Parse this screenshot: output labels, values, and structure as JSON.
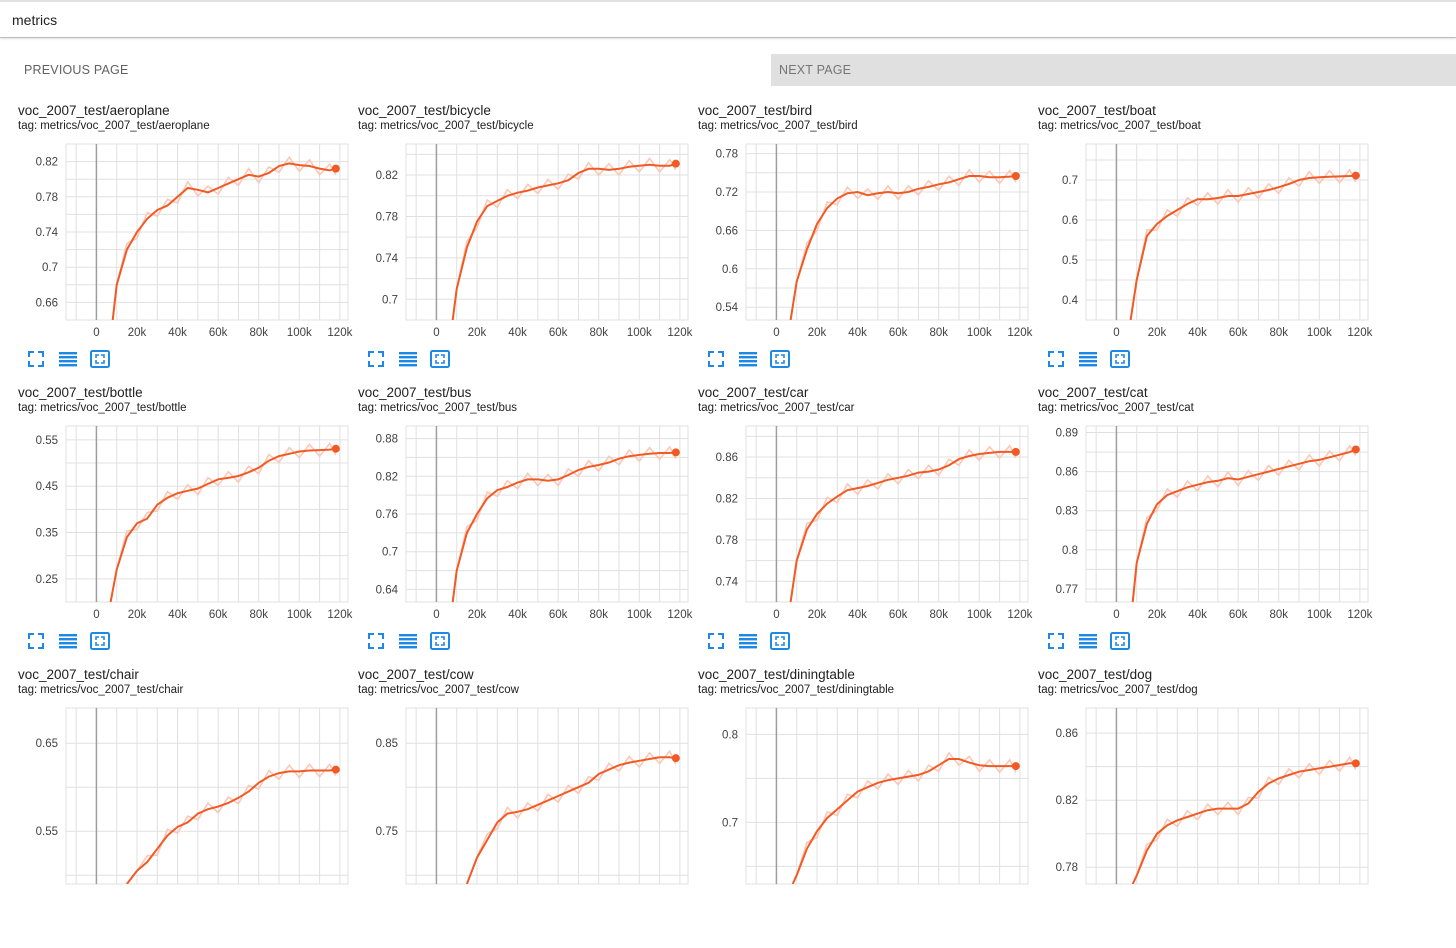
{
  "search": {
    "query": "metrics"
  },
  "pager": {
    "previous_label": "PREVIOUS PAGE",
    "next_label": "NEXT PAGE"
  },
  "colors": {
    "line": "#f15a24",
    "smoothed_raw": "#fcc7b5",
    "grid": "#e0e0e0",
    "zero_axis": "#9e9e9e",
    "icon": "#1e88e5"
  },
  "icons": [
    "fullscreen-icon",
    "toggle-lines-icon",
    "fit-domain-icon"
  ],
  "tag_prefix": "tag:",
  "cards": [
    {
      "title": "voc_2007_test/aeroplane",
      "tag": "metrics/voc_2007_test/aeroplane",
      "chart_data": {
        "type": "line",
        "x_ticks": [
          "0",
          "20k",
          "40k",
          "60k",
          "80k",
          "100k",
          "120k"
        ],
        "y_ticks": [
          "0.66",
          "0.7",
          "0.74",
          "0.78",
          "0.82"
        ],
        "ylim": [
          0.64,
          0.84
        ],
        "x": [
          8,
          10,
          15,
          20,
          25,
          30,
          35,
          40,
          45,
          50,
          55,
          60,
          65,
          70,
          75,
          80,
          85,
          90,
          95,
          100,
          105,
          110,
          115,
          118
        ],
        "y": [
          0.64,
          0.68,
          0.72,
          0.74,
          0.755,
          0.765,
          0.77,
          0.78,
          0.79,
          0.788,
          0.785,
          0.79,
          0.795,
          0.8,
          0.805,
          0.803,
          0.807,
          0.815,
          0.818,
          0.816,
          0.815,
          0.812,
          0.81,
          0.812
        ]
      }
    },
    {
      "title": "voc_2007_test/bicycle",
      "tag": "metrics/voc_2007_test/bicycle",
      "chart_data": {
        "type": "line",
        "x_ticks": [
          "0",
          "20k",
          "40k",
          "60k",
          "80k",
          "100k",
          "120k"
        ],
        "y_ticks": [
          "0.7",
          "0.74",
          "0.78",
          "0.82"
        ],
        "ylim": [
          0.68,
          0.85
        ],
        "x": [
          8,
          10,
          15,
          20,
          25,
          30,
          35,
          40,
          45,
          50,
          55,
          60,
          65,
          70,
          75,
          80,
          85,
          90,
          95,
          100,
          105,
          110,
          115,
          118
        ],
        "y": [
          0.68,
          0.71,
          0.75,
          0.775,
          0.79,
          0.795,
          0.8,
          0.803,
          0.805,
          0.808,
          0.81,
          0.812,
          0.815,
          0.822,
          0.826,
          0.826,
          0.825,
          0.826,
          0.828,
          0.829,
          0.83,
          0.829,
          0.829,
          0.831
        ]
      }
    },
    {
      "title": "voc_2007_test/bird",
      "tag": "metrics/voc_2007_test/bird",
      "chart_data": {
        "type": "line",
        "x_ticks": [
          "0",
          "20k",
          "40k",
          "60k",
          "80k",
          "100k",
          "120k"
        ],
        "y_ticks": [
          "0.54",
          "0.6",
          "0.66",
          "0.72",
          "0.78"
        ],
        "ylim": [
          0.52,
          0.795
        ],
        "x": [
          7,
          10,
          15,
          20,
          25,
          30,
          35,
          40,
          45,
          50,
          55,
          60,
          65,
          70,
          75,
          80,
          85,
          90,
          95,
          100,
          105,
          110,
          115,
          118
        ],
        "y": [
          0.52,
          0.58,
          0.63,
          0.67,
          0.695,
          0.71,
          0.718,
          0.72,
          0.715,
          0.718,
          0.72,
          0.718,
          0.72,
          0.725,
          0.728,
          0.732,
          0.735,
          0.74,
          0.745,
          0.745,
          0.743,
          0.743,
          0.744,
          0.745
        ]
      }
    },
    {
      "title": "voc_2007_test/boat",
      "tag": "metrics/voc_2007_test/boat",
      "chart_data": {
        "type": "line",
        "x_ticks": [
          "0",
          "20k",
          "40k",
          "60k",
          "80k",
          "100k",
          "120k"
        ],
        "y_ticks": [
          "0.4",
          "0.5",
          "0.6",
          "0.7"
        ],
        "ylim": [
          0.35,
          0.79
        ],
        "x": [
          7,
          10,
          15,
          20,
          25,
          30,
          35,
          40,
          45,
          50,
          55,
          60,
          65,
          70,
          75,
          80,
          85,
          90,
          95,
          100,
          105,
          110,
          115,
          118
        ],
        "y": [
          0.35,
          0.45,
          0.56,
          0.59,
          0.61,
          0.625,
          0.64,
          0.652,
          0.652,
          0.655,
          0.66,
          0.66,
          0.665,
          0.67,
          0.675,
          0.682,
          0.69,
          0.7,
          0.705,
          0.707,
          0.708,
          0.709,
          0.71,
          0.711
        ]
      }
    },
    {
      "title": "voc_2007_test/bottle",
      "tag": "metrics/voc_2007_test/bottle",
      "chart_data": {
        "type": "line",
        "x_ticks": [
          "0",
          "20k",
          "40k",
          "60k",
          "80k",
          "100k",
          "120k"
        ],
        "y_ticks": [
          "0.25",
          "0.35",
          "0.45",
          "0.55"
        ],
        "ylim": [
          0.2,
          0.58
        ],
        "x": [
          7,
          10,
          15,
          20,
          25,
          30,
          35,
          40,
          45,
          50,
          55,
          60,
          65,
          70,
          75,
          80,
          85,
          90,
          95,
          100,
          105,
          110,
          115,
          118
        ],
        "y": [
          0.2,
          0.27,
          0.34,
          0.37,
          0.38,
          0.41,
          0.425,
          0.435,
          0.44,
          0.445,
          0.455,
          0.465,
          0.468,
          0.472,
          0.48,
          0.49,
          0.505,
          0.515,
          0.52,
          0.525,
          0.527,
          0.528,
          0.529,
          0.531
        ]
      }
    },
    {
      "title": "voc_2007_test/bus",
      "tag": "metrics/voc_2007_test/bus",
      "chart_data": {
        "type": "line",
        "x_ticks": [
          "0",
          "20k",
          "40k",
          "60k",
          "80k",
          "100k",
          "120k"
        ],
        "y_ticks": [
          "0.64",
          "0.7",
          "0.76",
          "0.82",
          "0.88"
        ],
        "ylim": [
          0.62,
          0.9
        ],
        "x": [
          8,
          10,
          15,
          20,
          25,
          30,
          35,
          40,
          45,
          50,
          55,
          60,
          65,
          70,
          75,
          80,
          85,
          90,
          95,
          100,
          105,
          110,
          115,
          118
        ],
        "y": [
          0.62,
          0.67,
          0.73,
          0.76,
          0.785,
          0.798,
          0.803,
          0.81,
          0.815,
          0.815,
          0.813,
          0.815,
          0.822,
          0.83,
          0.835,
          0.838,
          0.842,
          0.848,
          0.852,
          0.854,
          0.856,
          0.857,
          0.857,
          0.858
        ]
      }
    },
    {
      "title": "voc_2007_test/car",
      "tag": "metrics/voc_2007_test/car",
      "chart_data": {
        "type": "line",
        "x_ticks": [
          "0",
          "20k",
          "40k",
          "60k",
          "80k",
          "100k",
          "120k"
        ],
        "y_ticks": [
          "0.74",
          "0.78",
          "0.82",
          "0.86"
        ],
        "ylim": [
          0.72,
          0.89
        ],
        "x": [
          7,
          10,
          15,
          20,
          25,
          30,
          35,
          40,
          45,
          50,
          55,
          60,
          65,
          70,
          75,
          80,
          85,
          90,
          95,
          100,
          105,
          110,
          115,
          118
        ],
        "y": [
          0.72,
          0.76,
          0.79,
          0.805,
          0.815,
          0.822,
          0.828,
          0.83,
          0.832,
          0.835,
          0.838,
          0.84,
          0.842,
          0.845,
          0.846,
          0.848,
          0.852,
          0.858,
          0.861,
          0.863,
          0.864,
          0.865,
          0.865,
          0.865
        ]
      }
    },
    {
      "title": "voc_2007_test/cat",
      "tag": "metrics/voc_2007_test/cat",
      "chart_data": {
        "type": "line",
        "x_ticks": [
          "0",
          "20k",
          "40k",
          "60k",
          "80k",
          "100k",
          "120k"
        ],
        "y_ticks": [
          "0.77",
          "0.8",
          "0.83",
          "0.86",
          "0.89"
        ],
        "ylim": [
          0.76,
          0.895
        ],
        "x": [
          8,
          10,
          15,
          20,
          25,
          30,
          35,
          40,
          45,
          50,
          55,
          60,
          65,
          70,
          75,
          80,
          85,
          90,
          95,
          100,
          105,
          110,
          115,
          118
        ],
        "y": [
          0.76,
          0.79,
          0.82,
          0.835,
          0.842,
          0.845,
          0.848,
          0.85,
          0.852,
          0.853,
          0.855,
          0.854,
          0.856,
          0.858,
          0.86,
          0.862,
          0.864,
          0.866,
          0.868,
          0.869,
          0.871,
          0.873,
          0.875,
          0.877
        ]
      }
    },
    {
      "title": "voc_2007_test/chair",
      "tag": "metrics/voc_2007_test/chair",
      "chart_data": {
        "type": "line",
        "x_ticks": [],
        "y_ticks": [
          "0.55",
          "0.65"
        ],
        "ylim": [
          0.49,
          0.69
        ],
        "x": [
          15,
          20,
          25,
          30,
          35,
          40,
          45,
          50,
          55,
          60,
          65,
          70,
          75,
          80,
          85,
          90,
          95,
          100,
          105,
          110,
          115,
          118
        ],
        "y": [
          0.49,
          0.505,
          0.515,
          0.53,
          0.545,
          0.555,
          0.56,
          0.57,
          0.575,
          0.578,
          0.582,
          0.588,
          0.595,
          0.605,
          0.612,
          0.616,
          0.618,
          0.618,
          0.619,
          0.619,
          0.619,
          0.62
        ]
      }
    },
    {
      "title": "voc_2007_test/cow",
      "tag": "metrics/voc_2007_test/cow",
      "chart_data": {
        "type": "line",
        "x_ticks": [],
        "y_ticks": [
          "0.75",
          "0.85"
        ],
        "ylim": [
          0.69,
          0.89
        ],
        "x": [
          15,
          20,
          25,
          30,
          35,
          40,
          45,
          50,
          55,
          60,
          65,
          70,
          75,
          80,
          85,
          90,
          95,
          100,
          105,
          110,
          115,
          118
        ],
        "y": [
          0.69,
          0.72,
          0.74,
          0.76,
          0.77,
          0.772,
          0.775,
          0.78,
          0.785,
          0.79,
          0.795,
          0.8,
          0.805,
          0.815,
          0.82,
          0.825,
          0.828,
          0.83,
          0.832,
          0.834,
          0.834,
          0.833
        ]
      }
    },
    {
      "title": "voc_2007_test/diningtable",
      "tag": "metrics/voc_2007_test/diningtable",
      "chart_data": {
        "type": "line",
        "x_ticks": [],
        "y_ticks": [
          "0.7",
          "0.8"
        ],
        "ylim": [
          0.63,
          0.83
        ],
        "x": [
          8,
          10,
          15,
          20,
          25,
          30,
          35,
          40,
          45,
          50,
          55,
          60,
          65,
          70,
          75,
          80,
          85,
          90,
          95,
          100,
          105,
          110,
          115,
          118
        ],
        "y": [
          0.63,
          0.64,
          0.67,
          0.69,
          0.705,
          0.715,
          0.725,
          0.735,
          0.74,
          0.745,
          0.748,
          0.75,
          0.752,
          0.754,
          0.758,
          0.765,
          0.772,
          0.772,
          0.768,
          0.765,
          0.764,
          0.764,
          0.764,
          0.764
        ]
      }
    },
    {
      "title": "voc_2007_test/dog",
      "tag": "metrics/voc_2007_test/dog",
      "chart_data": {
        "type": "line",
        "x_ticks": [],
        "y_ticks": [
          "0.78",
          "0.82",
          "0.86"
        ],
        "ylim": [
          0.77,
          0.875
        ],
        "x": [
          8,
          10,
          15,
          20,
          25,
          30,
          35,
          40,
          45,
          50,
          55,
          60,
          65,
          70,
          75,
          80,
          85,
          90,
          95,
          100,
          105,
          110,
          115,
          118
        ],
        "y": [
          0.77,
          0.775,
          0.79,
          0.8,
          0.805,
          0.808,
          0.81,
          0.812,
          0.814,
          0.815,
          0.815,
          0.815,
          0.818,
          0.825,
          0.83,
          0.833,
          0.835,
          0.837,
          0.838,
          0.839,
          0.84,
          0.841,
          0.842,
          0.842
        ]
      }
    }
  ]
}
